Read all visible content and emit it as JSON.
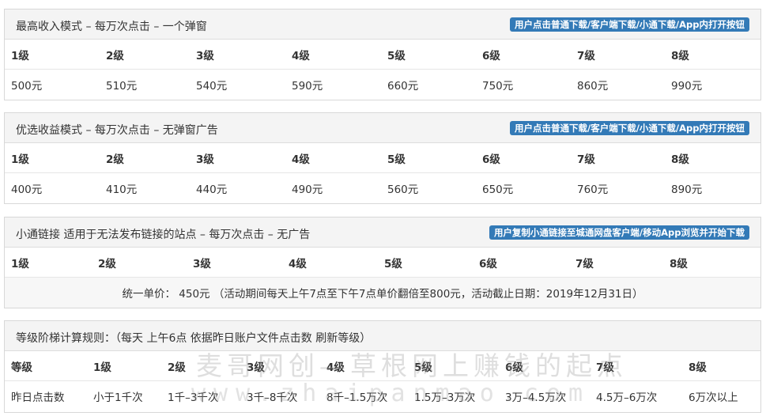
{
  "panels": [
    {
      "title": "最高收入模式 – 每万次点击 – 一个弹窗",
      "badge": "用户点击普通下载/客户端下载/小通下载/App内打开按钮",
      "levels": [
        "1级",
        "2级",
        "3级",
        "4级",
        "5级",
        "6级",
        "7级",
        "8级"
      ],
      "prices": [
        "500元",
        "510元",
        "540元",
        "590元",
        "660元",
        "750元",
        "860元",
        "990元"
      ]
    },
    {
      "title": "优选收益模式 – 每万次点击 – 无弹窗广告",
      "badge": "用户点击普通下载/客户端下载/小通下载/App内打开按钮",
      "levels": [
        "1级",
        "2级",
        "3级",
        "4级",
        "5级",
        "6级",
        "7级",
        "8级"
      ],
      "prices": [
        "400元",
        "410元",
        "440元",
        "490元",
        "560元",
        "650元",
        "760元",
        "890元"
      ]
    },
    {
      "title": "小通链接 适用于无法发布链接的站点 – 每万次点击 – 无广告",
      "badge": "用户复制小通链接至城通网盘客户端/移动App浏览并开始下载",
      "levels": [
        "1级",
        "2级",
        "3级",
        "4级",
        "5级",
        "6级",
        "7级",
        "8级"
      ],
      "unified_price": "统一单价： 450元 （活动期间每天上午7点至下午7点单价翻倍至800元，活动截止日期：2019年12月31日）"
    },
    {
      "title": "等级阶梯计算规则：（每天 上午6点 依据昨日账户文件点击数 刷新等级）",
      "header": [
        "等级",
        "1级",
        "2级",
        "3级",
        "4级",
        "5级",
        "6级",
        "7级",
        "8级"
      ],
      "row": [
        "昨日点击数",
        "小于1千次",
        "1千–3千次",
        "3千–8千次",
        "8千–1.5万次",
        "1.5万–3万次",
        "3万–4.5万次",
        "4.5万–6万次",
        "6万次以上"
      ]
    }
  ],
  "watermark": {
    "line1": "麦哥网创—草根网上赚钱的起点",
    "line2": "www.zhaipanmao.com"
  },
  "colors": {
    "badge": "#337ab7",
    "header_bg": "#f4f4f4",
    "shaded_row": "#f7f7f7"
  }
}
